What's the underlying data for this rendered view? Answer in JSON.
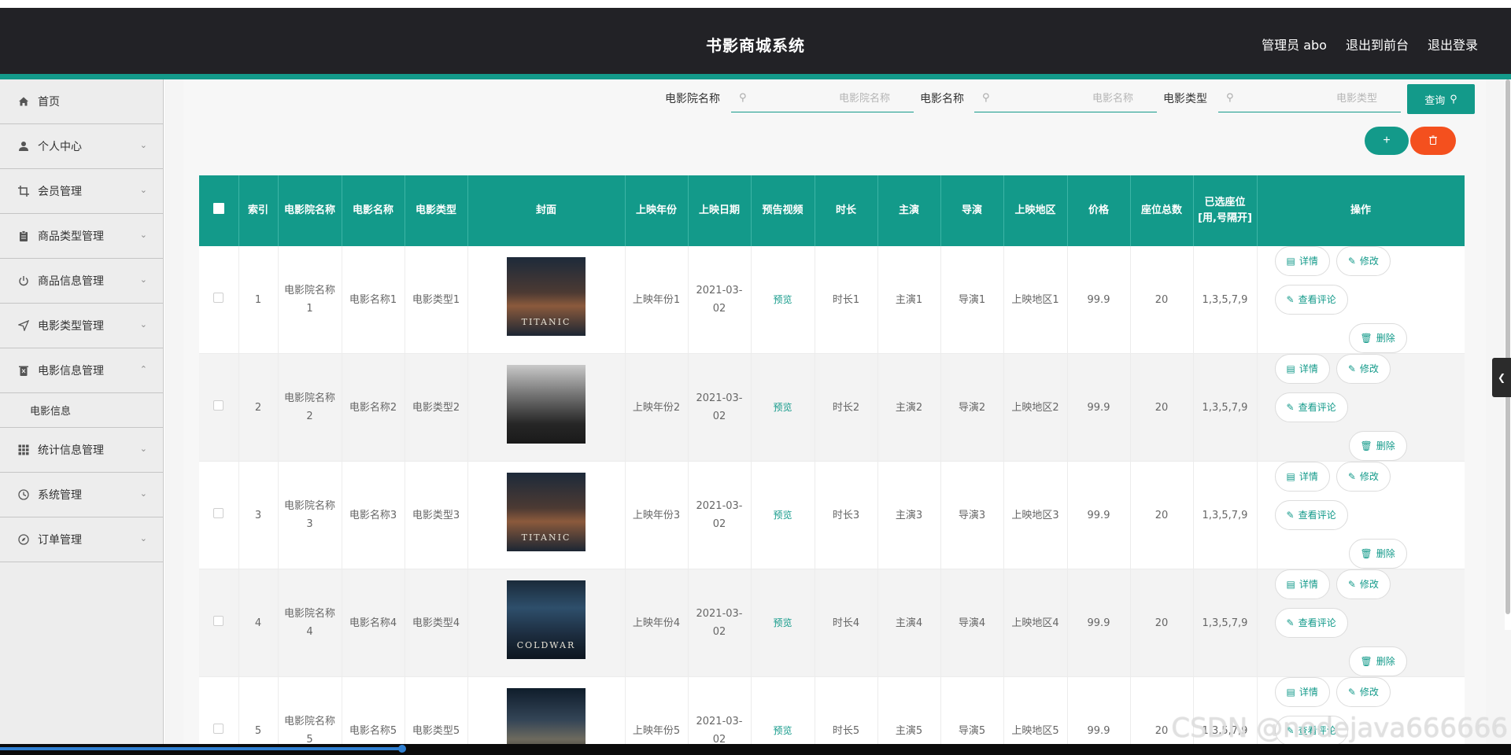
{
  "header": {
    "title": "书影商城系统",
    "admin_label": "管理员 abo",
    "to_front": "退出到前台",
    "logout": "退出登录"
  },
  "sidebar": {
    "items": [
      {
        "label": "首页",
        "icon": "home-icon"
      },
      {
        "label": "个人中心",
        "icon": "user-icon"
      },
      {
        "label": "会员管理",
        "icon": "crop-icon"
      },
      {
        "label": "商品类型管理",
        "icon": "clipboard-icon"
      },
      {
        "label": "商品信息管理",
        "icon": "power-icon"
      },
      {
        "label": "电影类型管理",
        "icon": "send-icon"
      },
      {
        "label": "电影信息管理",
        "icon": "trash-icon"
      },
      {
        "label": "统计信息管理",
        "icon": "grid-icon"
      },
      {
        "label": "系统管理",
        "icon": "clock-icon"
      },
      {
        "label": "订单管理",
        "icon": "compass-icon"
      }
    ],
    "submenu_label": "电影信息"
  },
  "search": {
    "cinema_label": "电影院名称",
    "cinema_placeholder": "电影院名称",
    "movie_label": "电影名称",
    "movie_placeholder": "电影名称",
    "type_label": "电影类型",
    "type_placeholder": "电影类型",
    "query_label": "查询"
  },
  "toolbar": {
    "add_icon": "plus-icon",
    "delete_icon": "trash-icon"
  },
  "table": {
    "headers": [
      "索引",
      "电影院名称",
      "电影名称",
      "电影类型",
      "封面",
      "上映年份",
      "上映日期",
      "预告视频",
      "时长",
      "主演",
      "导演",
      "上映地区",
      "价格",
      "座位总数",
      "已选座位[用,号隔开]",
      "操作"
    ],
    "rows": [
      {
        "index": "1",
        "cinema": "电影院名称1",
        "movie": "电影名称1",
        "type": "电影类型1",
        "cover": "TITANIC",
        "year": "上映年份1",
        "date": "2021-03-02",
        "preview": "预览",
        "duration": "时长1",
        "star": "主演1",
        "director": "导演1",
        "region": "上映地区1",
        "price": "99.9",
        "seats": "20",
        "selected": "1,3,5,7,9"
      },
      {
        "index": "2",
        "cinema": "电影院名称2",
        "movie": "电影名称2",
        "type": "电影类型2",
        "cover": "",
        "year": "上映年份2",
        "date": "2021-03-02",
        "preview": "预览",
        "duration": "时长2",
        "star": "主演2",
        "director": "导演2",
        "region": "上映地区2",
        "price": "99.9",
        "seats": "20",
        "selected": "1,3,5,7,9"
      },
      {
        "index": "3",
        "cinema": "电影院名称3",
        "movie": "电影名称3",
        "type": "电影类型3",
        "cover": "TITANIC",
        "year": "上映年份3",
        "date": "2021-03-02",
        "preview": "预览",
        "duration": "时长3",
        "star": "主演3",
        "director": "导演3",
        "region": "上映地区3",
        "price": "99.9",
        "seats": "20",
        "selected": "1,3,5,7,9"
      },
      {
        "index": "4",
        "cinema": "电影院名称4",
        "movie": "电影名称4",
        "type": "电影类型4",
        "cover": "COLDWAR",
        "year": "上映年份4",
        "date": "2021-03-02",
        "preview": "预览",
        "duration": "时长4",
        "star": "主演4",
        "director": "导演4",
        "region": "上映地区4",
        "price": "99.9",
        "seats": "20",
        "selected": "1,3,5,7,9"
      },
      {
        "index": "5",
        "cinema": "电影院名称5",
        "movie": "电影名称5",
        "type": "电影类型5",
        "cover": "",
        "year": "上映年份5",
        "date": "2021-03-02",
        "preview": "预览",
        "duration": "时长5",
        "star": "主演5",
        "director": "导演5",
        "region": "上映地区5",
        "price": "99.9",
        "seats": "20",
        "selected": "1,3,5,7,9"
      }
    ],
    "actions": {
      "detail": "详情",
      "edit": "修改",
      "review": "查看评论",
      "delete": "删除"
    }
  },
  "watermark": "CSDN @nodejava666666",
  "colors": {
    "header_bg": "#222226",
    "accent": "#139a8a",
    "danger": "#f4501e",
    "sidebar_bg": "#ededed"
  }
}
